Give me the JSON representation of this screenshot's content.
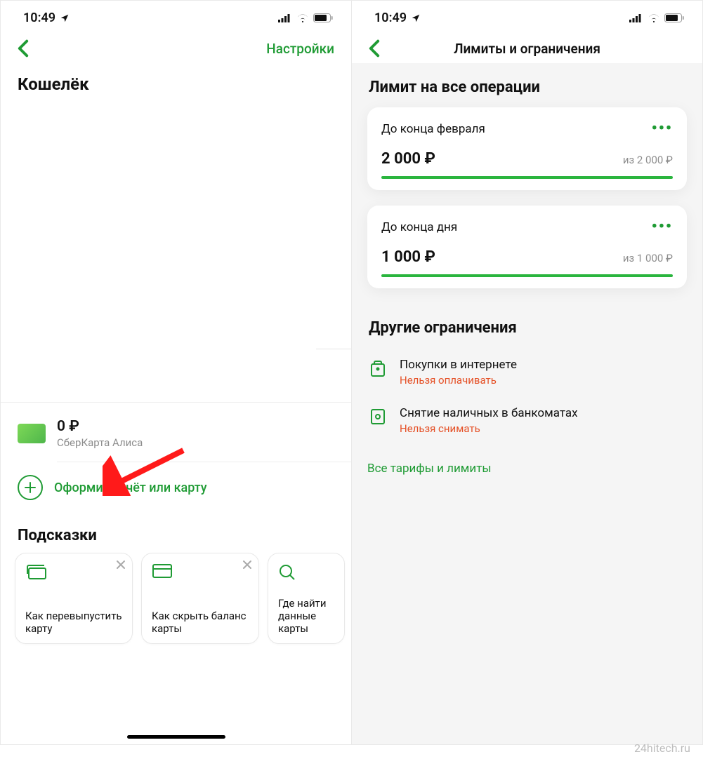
{
  "status": {
    "time": "10:49"
  },
  "left": {
    "settings": "Настройки",
    "title": "Кошелёк",
    "card": {
      "amount": "0 ₽",
      "name": "СберКарта Алиса"
    },
    "add": "Оформить счёт или карту",
    "tips_title": "Подсказки",
    "tips": [
      "Как перевыпустить карту",
      "Как скрыть баланс карты",
      "Где найти данные карты"
    ]
  },
  "right": {
    "nav_title": "Лимиты и ограничения",
    "section": "Лимит на все операции",
    "limits": [
      {
        "label": "До конца февраля",
        "cur": "2 000 ₽",
        "max": "из 2 000 ₽"
      },
      {
        "label": "До конца дня",
        "cur": "1 000 ₽",
        "max": "из 1 000 ₽"
      }
    ],
    "other_title": "Другие ограничения",
    "others": [
      {
        "title": "Покупки в интернете",
        "sub": "Нельзя оплачивать"
      },
      {
        "title": "Снятие наличных в банкоматах",
        "sub": "Нельзя снимать"
      }
    ],
    "all_link": "Все тарифы и лимиты"
  },
  "watermark": "24hitech.ru"
}
